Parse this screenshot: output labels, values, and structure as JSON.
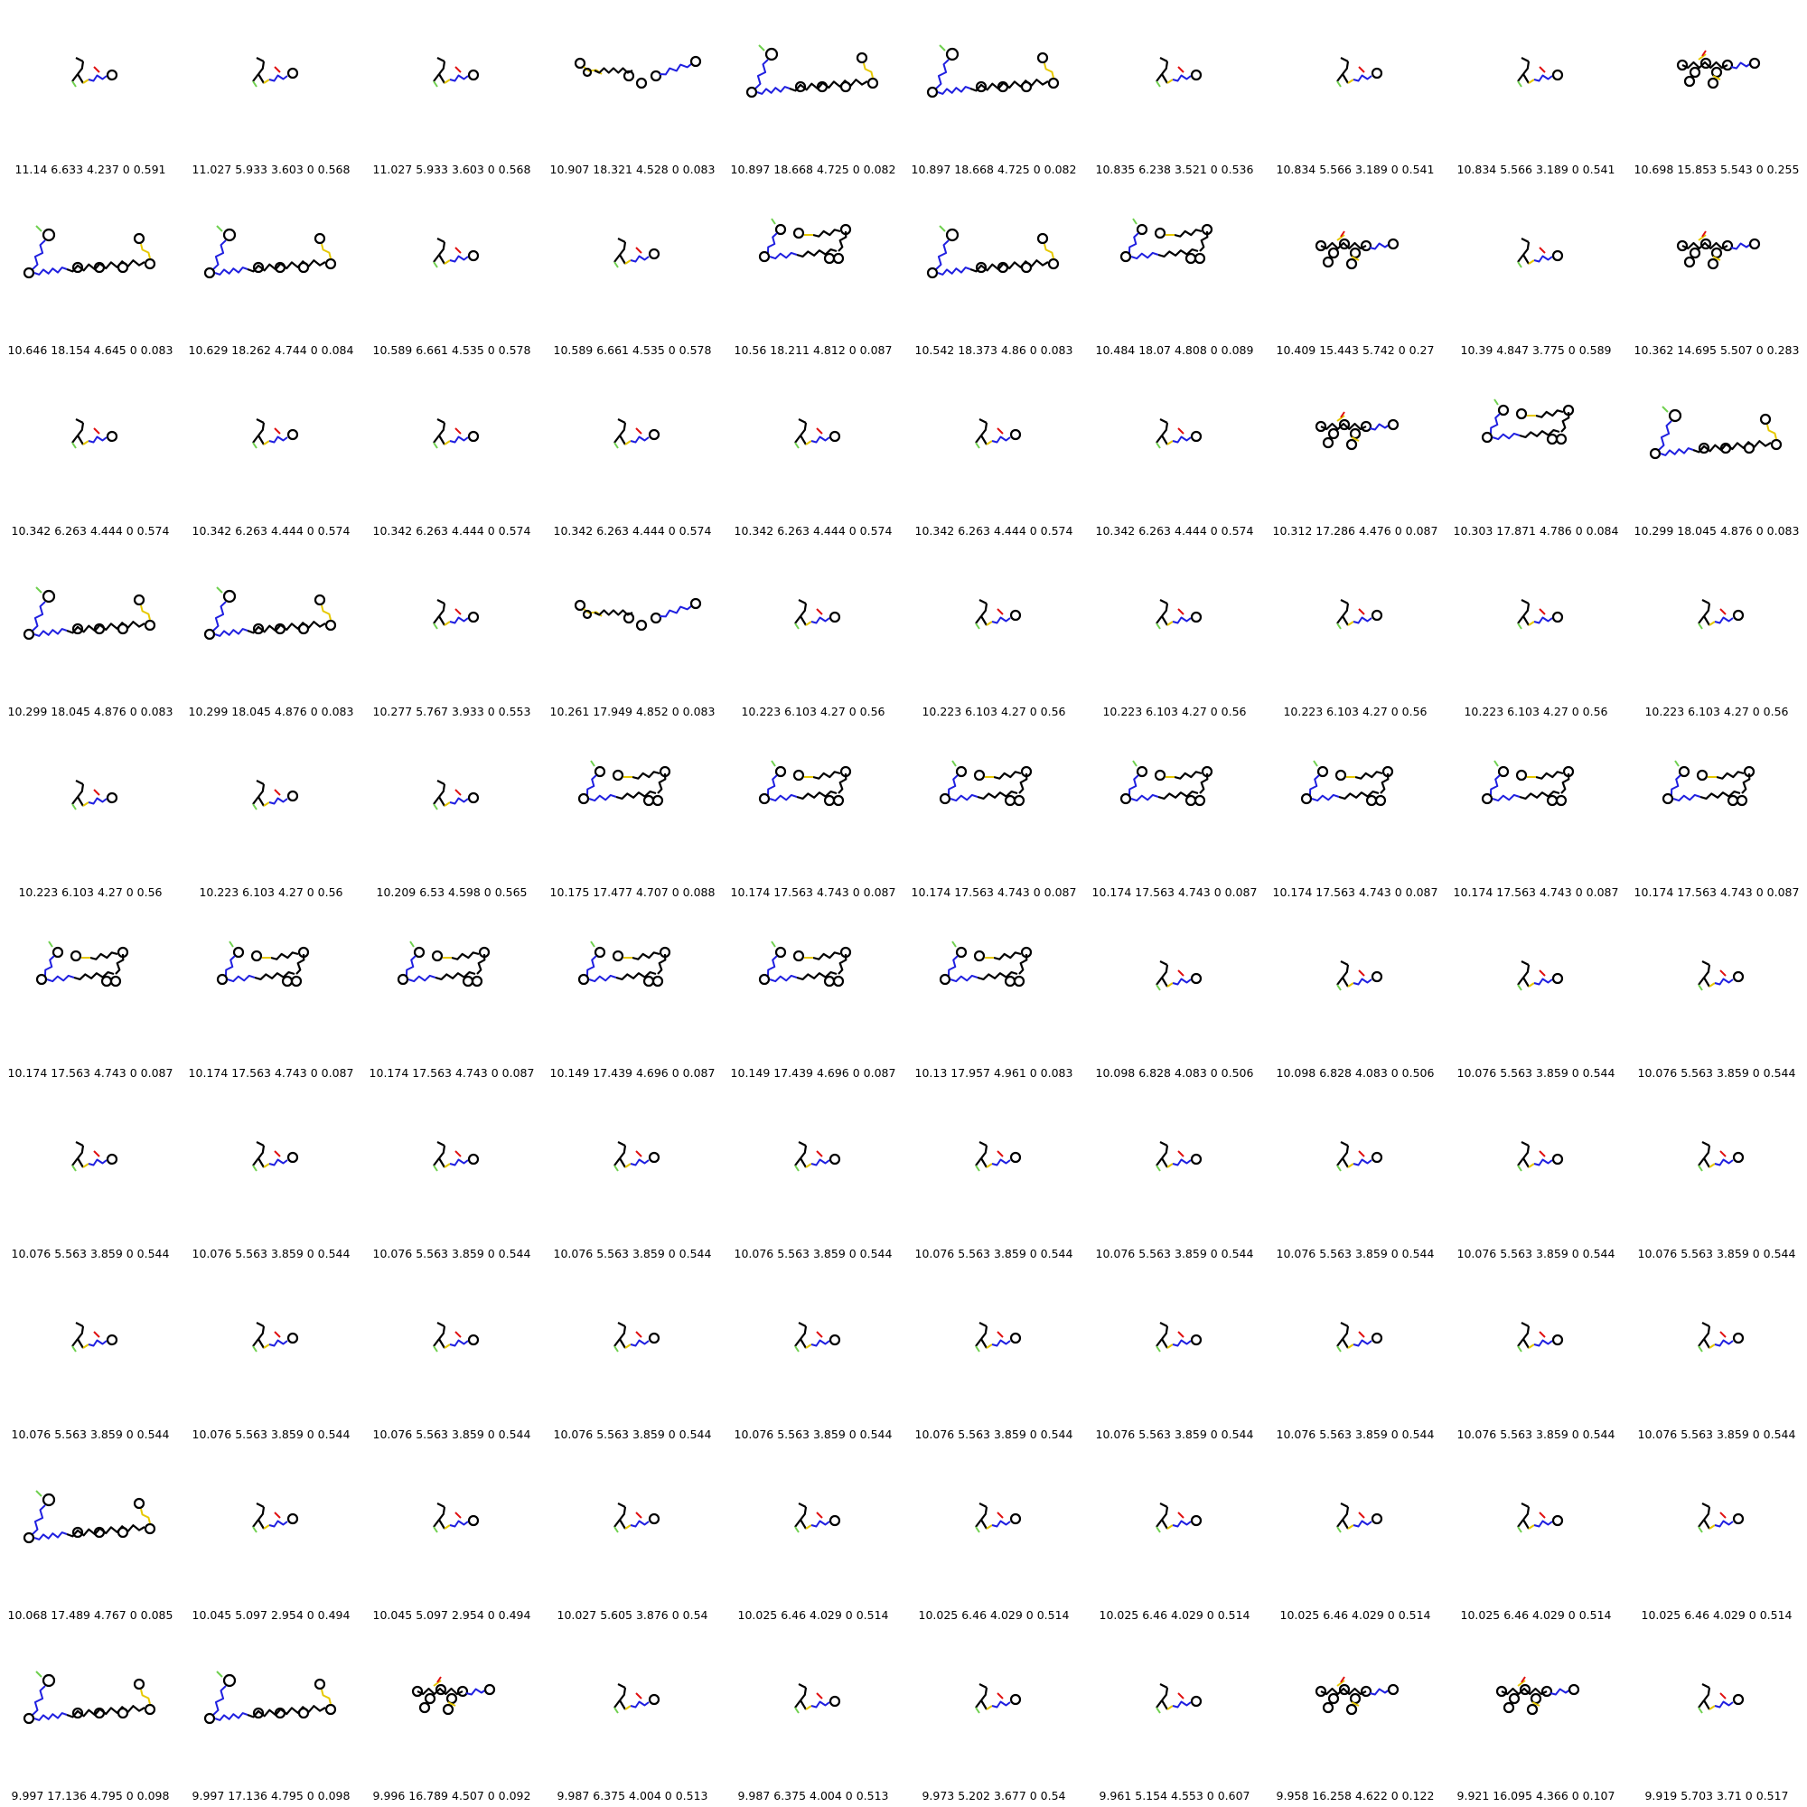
{
  "colors": {
    "carbon_bond": "#000000",
    "nitrogen": "#1f1fe0",
    "sulfur": "#e6c800",
    "oxygen": "#e01010",
    "fluorine": "#6fd04f",
    "background": "#ffffff"
  },
  "cells": [
    {
      "caption": "11.14 6.633 4.237 0 0.591",
      "shape": "small"
    },
    {
      "caption": "11.027 5.933 3.603 0 0.568",
      "shape": "small"
    },
    {
      "caption": "11.027 5.933 3.603 0 0.568",
      "shape": "small"
    },
    {
      "caption": "10.907 18.321 4.528 0 0.083",
      "shape": "wide"
    },
    {
      "caption": "10.897 18.668 4.725 0 0.082",
      "shape": "chain"
    },
    {
      "caption": "10.897 18.668 4.725 0 0.082",
      "shape": "chain"
    },
    {
      "caption": "10.835 6.238 3.521 0 0.536",
      "shape": "small"
    },
    {
      "caption": "10.834 5.566 3.189 0 0.541",
      "shape": "small"
    },
    {
      "caption": "10.834 5.566 3.189 0 0.541",
      "shape": "small"
    },
    {
      "caption": "10.698 15.853 5.543 0 0.255",
      "shape": "cluster"
    },
    {
      "caption": "10.646 18.154 4.645 0 0.083",
      "shape": "chain"
    },
    {
      "caption": "10.629 18.262 4.744 0 0.084",
      "shape": "chain"
    },
    {
      "caption": "10.589 6.661 4.535 0 0.578",
      "shape": "small"
    },
    {
      "caption": "10.589 6.661 4.535 0 0.578",
      "shape": "small"
    },
    {
      "caption": "10.56 18.211 4.812 0 0.087",
      "shape": "loop"
    },
    {
      "caption": "10.542 18.373 4.86 0 0.083",
      "shape": "chain"
    },
    {
      "caption": "10.484 18.07 4.808 0 0.089",
      "shape": "loop"
    },
    {
      "caption": "10.409 15.443 5.742 0 0.27",
      "shape": "cluster"
    },
    {
      "caption": "10.39 4.847 3.775 0 0.589",
      "shape": "small"
    },
    {
      "caption": "10.362 14.695 5.507 0 0.283",
      "shape": "cluster"
    },
    {
      "caption": "10.342 6.263 4.444 0 0.574",
      "shape": "small"
    },
    {
      "caption": "10.342 6.263 4.444 0 0.574",
      "shape": "small"
    },
    {
      "caption": "10.342 6.263 4.444 0 0.574",
      "shape": "small"
    },
    {
      "caption": "10.342 6.263 4.444 0 0.574",
      "shape": "small"
    },
    {
      "caption": "10.342 6.263 4.444 0 0.574",
      "shape": "small"
    },
    {
      "caption": "10.342 6.263 4.444 0 0.574",
      "shape": "small"
    },
    {
      "caption": "10.342 6.263 4.444 0 0.574",
      "shape": "small"
    },
    {
      "caption": "10.312 17.286 4.476 0 0.087",
      "shape": "cluster"
    },
    {
      "caption": "10.303 17.871 4.786 0 0.084",
      "shape": "loop"
    },
    {
      "caption": "10.299 18.045 4.876 0 0.083",
      "shape": "chain"
    },
    {
      "caption": "10.299 18.045 4.876 0 0.083",
      "shape": "chain"
    },
    {
      "caption": "10.299 18.045 4.876 0 0.083",
      "shape": "chain"
    },
    {
      "caption": "10.277 5.767 3.933 0 0.553",
      "shape": "small"
    },
    {
      "caption": "10.261 17.949 4.852 0 0.083",
      "shape": "wide"
    },
    {
      "caption": "10.223 6.103 4.27 0 0.56",
      "shape": "small"
    },
    {
      "caption": "10.223 6.103 4.27 0 0.56",
      "shape": "small"
    },
    {
      "caption": "10.223 6.103 4.27 0 0.56",
      "shape": "small"
    },
    {
      "caption": "10.223 6.103 4.27 0 0.56",
      "shape": "small"
    },
    {
      "caption": "10.223 6.103 4.27 0 0.56",
      "shape": "small"
    },
    {
      "caption": "10.223 6.103 4.27 0 0.56",
      "shape": "small"
    },
    {
      "caption": "10.223 6.103 4.27 0 0.56",
      "shape": "small"
    },
    {
      "caption": "10.223 6.103 4.27 0 0.56",
      "shape": "small"
    },
    {
      "caption": "10.209 6.53 4.598 0 0.565",
      "shape": "small"
    },
    {
      "caption": "10.175 17.477 4.707 0 0.088",
      "shape": "loop"
    },
    {
      "caption": "10.174 17.563 4.743 0 0.087",
      "shape": "loop"
    },
    {
      "caption": "10.174 17.563 4.743 0 0.087",
      "shape": "loop"
    },
    {
      "caption": "10.174 17.563 4.743 0 0.087",
      "shape": "loop"
    },
    {
      "caption": "10.174 17.563 4.743 0 0.087",
      "shape": "loop"
    },
    {
      "caption": "10.174 17.563 4.743 0 0.087",
      "shape": "loop"
    },
    {
      "caption": "10.174 17.563 4.743 0 0.087",
      "shape": "loop"
    },
    {
      "caption": "10.174 17.563 4.743 0 0.087",
      "shape": "loop"
    },
    {
      "caption": "10.174 17.563 4.743 0 0.087",
      "shape": "loop"
    },
    {
      "caption": "10.174 17.563 4.743 0 0.087",
      "shape": "loop"
    },
    {
      "caption": "10.149 17.439 4.696 0 0.087",
      "shape": "loop"
    },
    {
      "caption": "10.149 17.439 4.696 0 0.087",
      "shape": "loop"
    },
    {
      "caption": "10.13 17.957 4.961 0 0.083",
      "shape": "loop"
    },
    {
      "caption": "10.098 6.828 4.083 0 0.506",
      "shape": "small"
    },
    {
      "caption": "10.098 6.828 4.083 0 0.506",
      "shape": "small"
    },
    {
      "caption": "10.076 5.563 3.859 0 0.544",
      "shape": "small"
    },
    {
      "caption": "10.076 5.563 3.859 0 0.544",
      "shape": "small"
    },
    {
      "caption": "10.076 5.563 3.859 0 0.544",
      "shape": "small"
    },
    {
      "caption": "10.076 5.563 3.859 0 0.544",
      "shape": "small"
    },
    {
      "caption": "10.076 5.563 3.859 0 0.544",
      "shape": "small"
    },
    {
      "caption": "10.076 5.563 3.859 0 0.544",
      "shape": "small"
    },
    {
      "caption": "10.076 5.563 3.859 0 0.544",
      "shape": "small"
    },
    {
      "caption": "10.076 5.563 3.859 0 0.544",
      "shape": "small"
    },
    {
      "caption": "10.076 5.563 3.859 0 0.544",
      "shape": "small"
    },
    {
      "caption": "10.076 5.563 3.859 0 0.544",
      "shape": "small"
    },
    {
      "caption": "10.076 5.563 3.859 0 0.544",
      "shape": "small"
    },
    {
      "caption": "10.076 5.563 3.859 0 0.544",
      "shape": "small"
    },
    {
      "caption": "10.076 5.563 3.859 0 0.544",
      "shape": "small"
    },
    {
      "caption": "10.076 5.563 3.859 0 0.544",
      "shape": "small"
    },
    {
      "caption": "10.076 5.563 3.859 0 0.544",
      "shape": "small"
    },
    {
      "caption": "10.076 5.563 3.859 0 0.544",
      "shape": "small"
    },
    {
      "caption": "10.076 5.563 3.859 0 0.544",
      "shape": "small"
    },
    {
      "caption": "10.076 5.563 3.859 0 0.544",
      "shape": "small"
    },
    {
      "caption": "10.076 5.563 3.859 0 0.544",
      "shape": "small"
    },
    {
      "caption": "10.076 5.563 3.859 0 0.544",
      "shape": "small"
    },
    {
      "caption": "10.076 5.563 3.859 0 0.544",
      "shape": "small"
    },
    {
      "caption": "10.076 5.563 3.859 0 0.544",
      "shape": "small"
    },
    {
      "caption": "10.068 17.489 4.767 0 0.085",
      "shape": "chain"
    },
    {
      "caption": "10.045 5.097 2.954 0 0.494",
      "shape": "small"
    },
    {
      "caption": "10.045 5.097 2.954 0 0.494",
      "shape": "small"
    },
    {
      "caption": "10.027 5.605 3.876 0 0.54",
      "shape": "small"
    },
    {
      "caption": "10.025 6.46 4.029 0 0.514",
      "shape": "small"
    },
    {
      "caption": "10.025 6.46 4.029 0 0.514",
      "shape": "small"
    },
    {
      "caption": "10.025 6.46 4.029 0 0.514",
      "shape": "small"
    },
    {
      "caption": "10.025 6.46 4.029 0 0.514",
      "shape": "small"
    },
    {
      "caption": "10.025 6.46 4.029 0 0.514",
      "shape": "small"
    },
    {
      "caption": "10.025 6.46 4.029 0 0.514",
      "shape": "small"
    },
    {
      "caption": "9.997 17.136 4.795 0 0.098",
      "shape": "chain"
    },
    {
      "caption": "9.997 17.136 4.795 0 0.098",
      "shape": "chain"
    },
    {
      "caption": "9.996 16.789 4.507 0 0.092",
      "shape": "cluster"
    },
    {
      "caption": "9.987 6.375 4.004 0 0.513",
      "shape": "small"
    },
    {
      "caption": "9.987 6.375 4.004 0 0.513",
      "shape": "small"
    },
    {
      "caption": "9.973 5.202 3.677 0 0.54",
      "shape": "small"
    },
    {
      "caption": "9.961 5.154 4.553 0 0.607",
      "shape": "small"
    },
    {
      "caption": "9.958 16.258 4.622 0 0.122",
      "shape": "cluster"
    },
    {
      "caption": "9.921 16.095 4.366 0 0.107",
      "shape": "cluster"
    },
    {
      "caption": "9.919 5.703 3.71 0 0.517",
      "shape": "small"
    }
  ]
}
